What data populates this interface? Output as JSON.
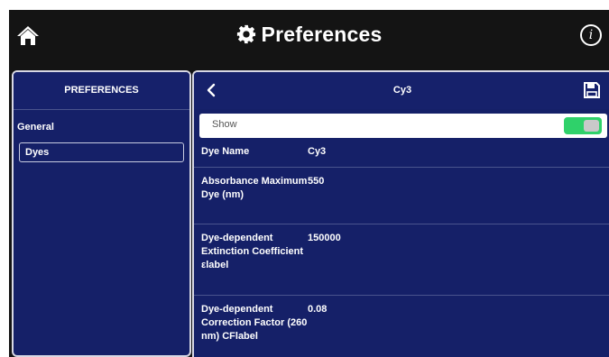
{
  "header": {
    "title": "Preferences"
  },
  "sidebar": {
    "heading": "PREFERENCES",
    "group": "General",
    "items": [
      {
        "label": "Dyes",
        "selected": true
      }
    ]
  },
  "detail": {
    "title": "Cy3",
    "show": {
      "label": "Show",
      "enabled": true
    },
    "fields": [
      {
        "label": "Dye Name",
        "value": "Cy3"
      },
      {
        "label": "Absorbance Maximum Dye (nm)",
        "value": "550"
      },
      {
        "label": "Dye-dependent Extinction Coefficient εlabel",
        "value": "150000"
      },
      {
        "label": "Dye-dependent Correction Factor (260 nm) CFlabel",
        "value": "0.08"
      }
    ]
  },
  "icons": {
    "home": "home-icon",
    "settings": "gear-icon",
    "info": "info-icon",
    "back": "chevron-left-icon",
    "save": "save-icon"
  },
  "colors": {
    "panel": "#152068",
    "topbar": "#141414",
    "toggle_on": "#2fd16a",
    "border": "#d8d8e4"
  }
}
